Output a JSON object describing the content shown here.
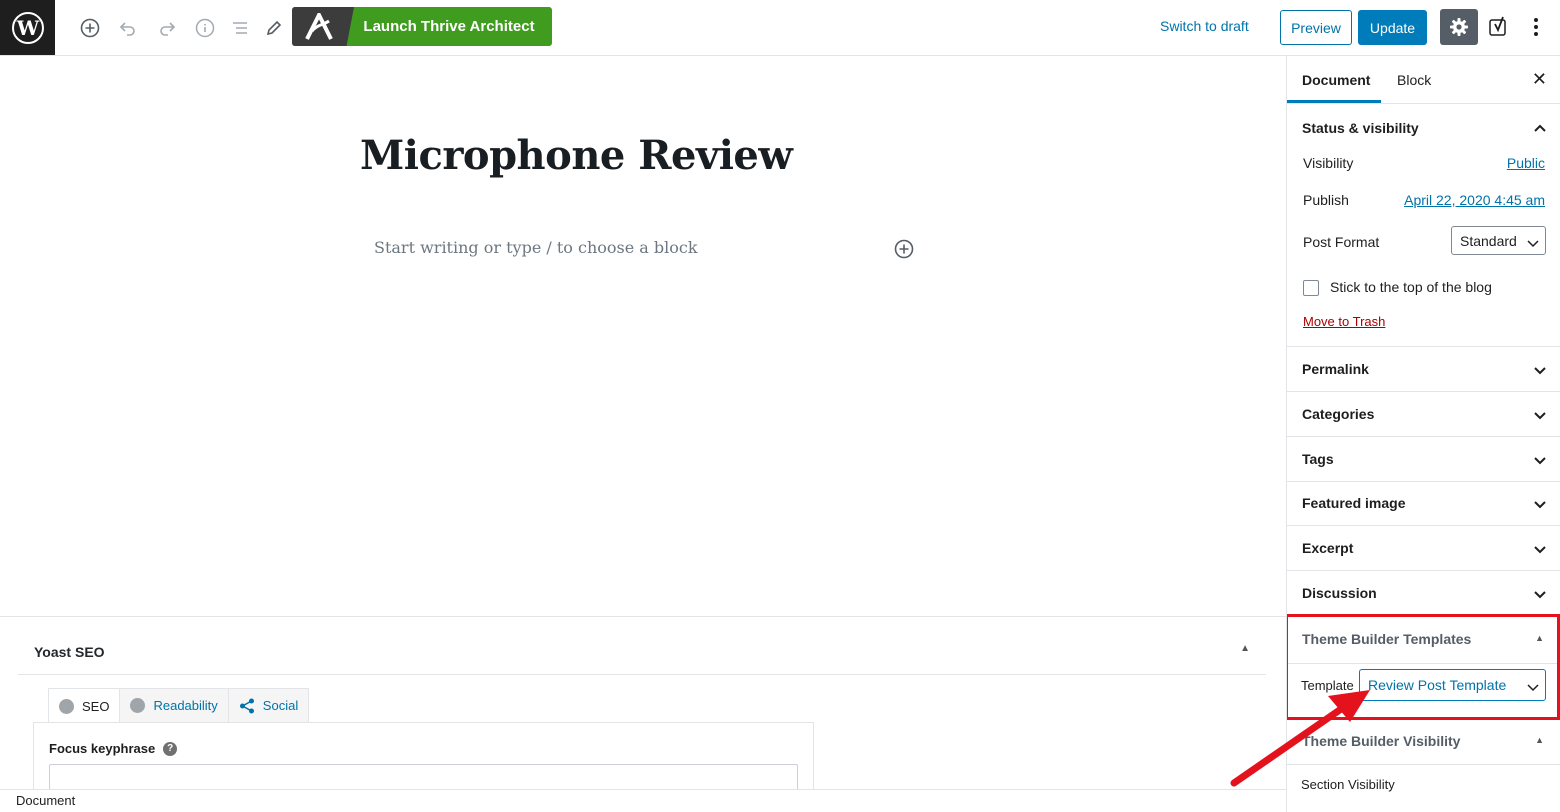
{
  "toolbar": {
    "thrive_label": "Launch Thrive Architect",
    "switch_draft": "Switch to draft",
    "preview": "Preview",
    "update": "Update"
  },
  "post": {
    "title": "Microphone Review",
    "placeholder": "Start writing or type / to choose a block"
  },
  "sidebar": {
    "tabs": [
      "Document",
      "Block"
    ],
    "status": {
      "title": "Status & visibility",
      "visibility_label": "Visibility",
      "visibility_value": "Public",
      "publish_label": "Publish",
      "publish_value": "April 22, 2020 4:45 am",
      "format_label": "Post Format",
      "format_value": "Standard",
      "stick_label": "Stick to the top of the blog",
      "trash": "Move to Trash"
    },
    "panels": [
      "Permalink",
      "Categories",
      "Tags",
      "Featured image",
      "Excerpt",
      "Discussion"
    ],
    "theme_builder_templates": {
      "title": "Theme Builder Templates",
      "template_label": "Template",
      "template_value": "Review Post Template"
    },
    "theme_builder_visibility": {
      "title": "Theme Builder Visibility",
      "section_label": "Section Visibility"
    }
  },
  "yoast": {
    "title": "Yoast SEO",
    "tabs": [
      "SEO",
      "Readability",
      "Social"
    ],
    "focus_label": "Focus keyphrase",
    "help": "?"
  },
  "footer": {
    "breadcrumb": "Document"
  },
  "colors": {
    "accent": "#007cba",
    "thrive_green": "#3f9c1e",
    "highlight_red": "#e3121c"
  }
}
